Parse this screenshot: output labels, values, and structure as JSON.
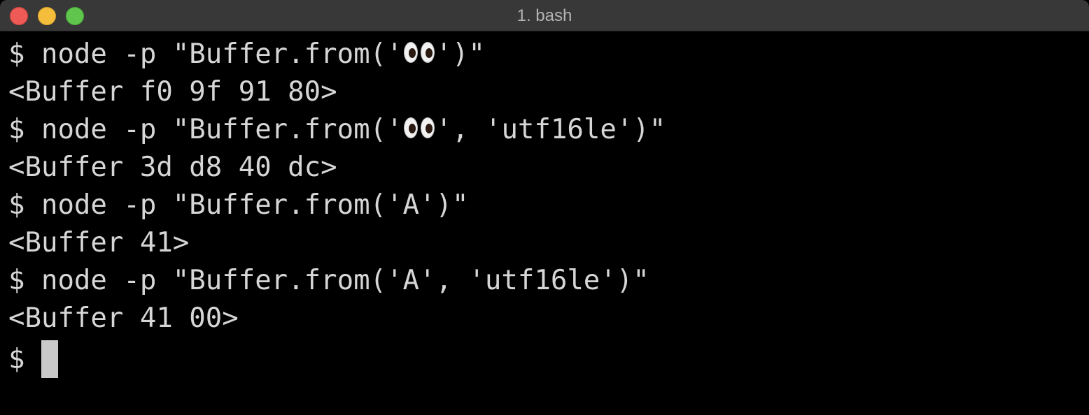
{
  "window": {
    "title": "1. bash"
  },
  "terminal": {
    "lines": [
      {
        "prefix": "$ node -p \"Buffer.from('",
        "emoji": "eyes-emoji",
        "suffix": "')\""
      },
      {
        "text": "<Buffer f0 9f 91 80>"
      },
      {
        "prefix": "$ node -p \"Buffer.from('",
        "emoji": "eyes-emoji",
        "suffix": "', 'utf16le')\""
      },
      {
        "text": "<Buffer 3d d8 40 dc>"
      },
      {
        "text": "$ node -p \"Buffer.from('A')\""
      },
      {
        "text": "<Buffer 41>"
      },
      {
        "text": "$ node -p \"Buffer.from('A', 'utf16le')\""
      },
      {
        "text": "<Buffer 41 00>"
      },
      {
        "prompt": "$ "
      }
    ]
  },
  "colors": {
    "background": "#000000",
    "foreground": "#d6d6d6",
    "titlebar": "#383838",
    "close": "#ee5b56",
    "minimize": "#f4bd3b",
    "zoom": "#5fc54c",
    "cursor": "#c9c9c9"
  }
}
